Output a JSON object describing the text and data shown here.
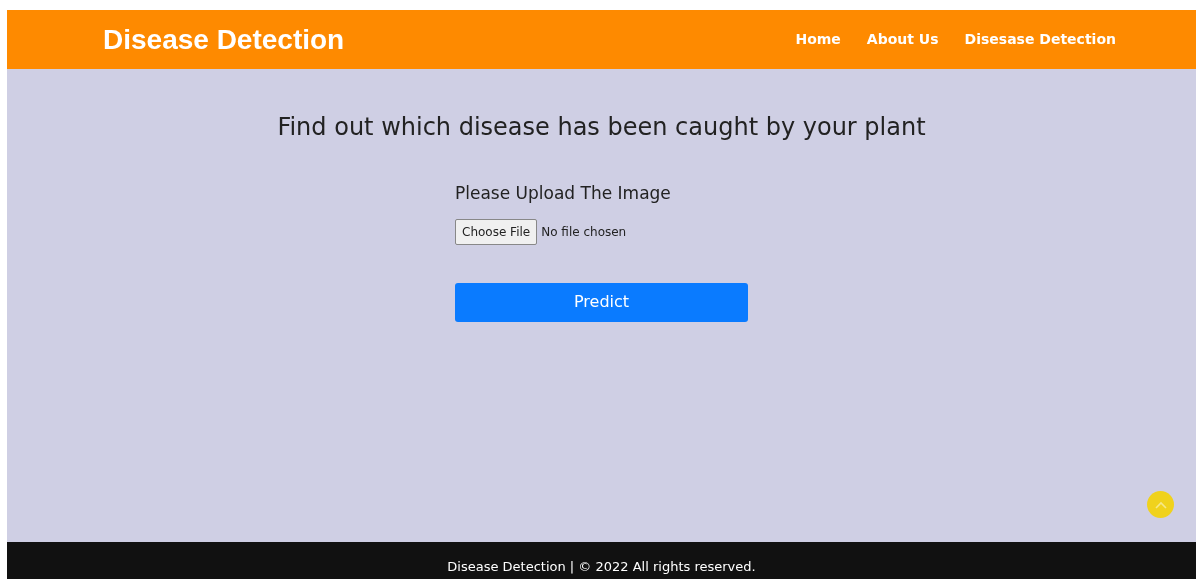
{
  "header": {
    "brand": "Disease Detection",
    "nav": [
      {
        "label": "Home"
      },
      {
        "label": "About Us"
      },
      {
        "label": "Disesase Detection"
      }
    ]
  },
  "main": {
    "heading": "Find out which disease has been caught by your plant",
    "upload_label": "Please Upload The Image",
    "file_button": "Choose File",
    "file_status": "No file chosen",
    "submit": "Predict"
  },
  "footer": {
    "text": "Disease Detection | © 2022 All rights reserved."
  }
}
